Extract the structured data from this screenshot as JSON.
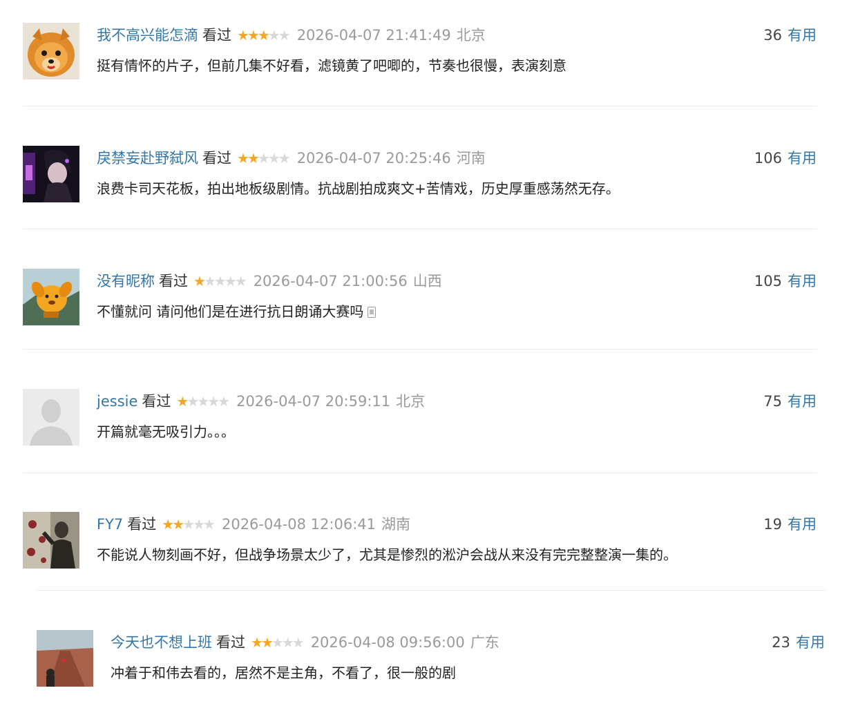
{
  "reviews": [
    {
      "username": "我不高兴能怎滴",
      "watched": "看过",
      "rating": 3,
      "stars_text": [
        "★",
        "★",
        "★",
        "★",
        "★"
      ],
      "time": "2026-04-07 21:41:49",
      "location": "北京",
      "votes": "36",
      "vote_label": "有用",
      "content": "挺有情怀的片子，但前几集不好看，滤镜黄了吧唧的，节奏也很慢，表演刻意",
      "avatar_icon": "pomeranian-dog-icon"
    },
    {
      "username": "戾禁妄赴野弑风",
      "watched": "看过",
      "rating": 2,
      "stars_text": [
        "★",
        "★",
        "★",
        "★",
        "★"
      ],
      "time": "2026-04-07 20:25:46",
      "location": "河南",
      "votes": "106",
      "vote_label": "有用",
      "content": "浪费卡司天花板，拍出地板级剧情。抗战剧拍成爽文+苦情戏，历史厚重感荡然无存。",
      "avatar_icon": "anime-character-icon"
    },
    {
      "username": "没有昵称",
      "watched": "看过",
      "rating": 1,
      "stars_text": [
        "★",
        "★",
        "★",
        "★",
        "★"
      ],
      "time": "2026-04-07 21:00:56",
      "location": "山西",
      "votes": "105",
      "vote_label": "有用",
      "content": "不懂就问 请问他们是在进行抗日朗诵大赛吗",
      "avatar_icon": "cartoon-dog-icon"
    },
    {
      "username": "jessie",
      "watched": "看过",
      "rating": 1,
      "stars_text": [
        "★",
        "★",
        "★",
        "★",
        "★"
      ],
      "time": "2026-04-07 20:59:11",
      "location": "北京",
      "votes": "75",
      "vote_label": "有用",
      "content": "开篇就毫无吸引力。。。",
      "avatar_icon": "default-user-icon"
    },
    {
      "username": "FY7",
      "watched": "看过",
      "rating": 2,
      "stars_text": [
        "★",
        "★",
        "★",
        "★",
        "★"
      ],
      "time": "2026-04-08 12:06:41",
      "location": "湖南",
      "votes": "19",
      "vote_label": "有用",
      "content": "不能说人物刻画不好，但战争场景太少了，尤其是惨烈的淞沪会战从来没有完完整整演一集的。",
      "avatar_icon": "movie-poster-icon"
    },
    {
      "username": "今天也不想上班",
      "watched": "看过",
      "rating": 2,
      "stars_text": [
        "★",
        "★",
        "★",
        "★",
        "★"
      ],
      "time": "2026-04-08 09:56:00",
      "location": "广东",
      "votes": "23",
      "vote_label": "有用",
      "content": "冲着于和伟去看的，居然不是主角，不看了，很一般的剧",
      "avatar_icon": "road-landscape-icon"
    }
  ],
  "colors": {
    "username": "#3377aa",
    "star_on": "#f5a623",
    "star_off": "#d8d8d8",
    "meta_gray": "#9a9a9a"
  }
}
